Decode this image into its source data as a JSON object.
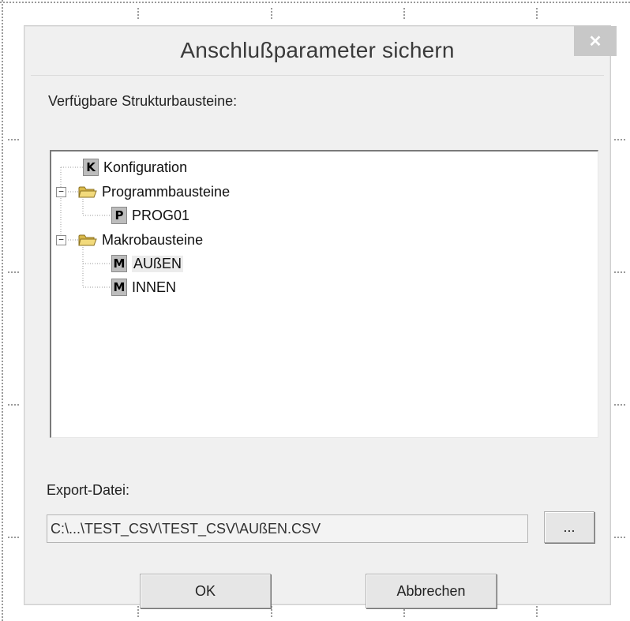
{
  "dialog": {
    "title": "Anschlußparameter sichern",
    "close_icon": "close-icon"
  },
  "tree_section": {
    "label": "Verfügbare Strukturbausteine:"
  },
  "tree": {
    "nodes": [
      {
        "label": "Konfiguration",
        "icon": "K",
        "type": "konfiguration-icon"
      },
      {
        "label": "Programmbausteine",
        "icon": "folder-icon",
        "expanded": true
      },
      {
        "label": "PROG01",
        "icon": "P",
        "type": "program-icon"
      },
      {
        "label": "Makrobausteine",
        "icon": "folder-icon",
        "expanded": true
      },
      {
        "label": "AUßEN",
        "icon": "M",
        "type": "macro-icon",
        "selected": true
      },
      {
        "label": "INNEN",
        "icon": "M",
        "type": "macro-icon"
      }
    ]
  },
  "export": {
    "label": "Export-Datei:",
    "value": "C:\\...\\TEST_CSV\\TEST_CSV\\AUßEN.CSV",
    "browse_label": "..."
  },
  "buttons": {
    "ok": "OK",
    "cancel": "Abbrechen"
  }
}
